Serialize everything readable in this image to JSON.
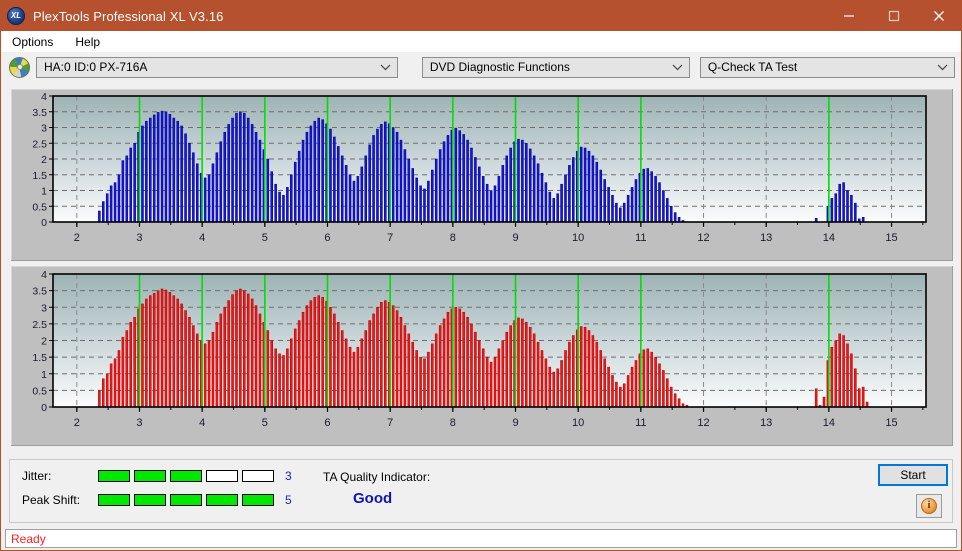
{
  "window": {
    "title": "PlexTools Professional XL V3.16",
    "app_icon": "xl-disc-icon",
    "icon_label": "XL",
    "accent_color": "#b5512e",
    "minimize_label": "Minimize",
    "maximize_label": "Maximize",
    "close_label": "Close"
  },
  "menubar": {
    "items": [
      {
        "label": "Options"
      },
      {
        "label": "Help"
      }
    ]
  },
  "toolbar": {
    "drive_icon": "disc-icon",
    "drive_select": {
      "value": "HA:0 ID:0  PX-716A",
      "options": [
        "HA:0 ID:0  PX-716A"
      ]
    },
    "function_select": {
      "value": "DVD Diagnostic Functions",
      "options": [
        "DVD Diagnostic Functions"
      ]
    },
    "test_select": {
      "value": "Q-Check TA Test",
      "options": [
        "Q-Check TA Test"
      ]
    }
  },
  "results": {
    "jitter": {
      "label": "Jitter:",
      "value": "3",
      "segments_total": 5,
      "segments_filled": 3
    },
    "peak_shift": {
      "label": "Peak Shift:",
      "value": "5",
      "segments_total": 5,
      "segments_filled": 5
    },
    "ta_quality": {
      "label": "TA Quality Indicator:",
      "value": "Good",
      "value_color": "#1414b4"
    },
    "start_button": "Start",
    "info_button": "info-icon",
    "info_glyph": "i"
  },
  "statusbar": {
    "text": "Ready",
    "color": "#ff2020"
  },
  "chart_data": [
    {
      "id": "top",
      "type": "bar",
      "title": "",
      "series_name": "Jitter",
      "color": "#1414e6",
      "bar_edge_color": "#000080",
      "xlabel": "",
      "ylabel": "",
      "xlim": [
        1.62,
        15.55
      ],
      "ylim": [
        0,
        4
      ],
      "yticks": [
        0,
        0.5,
        1,
        1.5,
        2,
        2.5,
        3,
        3.5,
        4
      ],
      "ytick_labels": [
        "0",
        "0.5",
        "1",
        "1.5",
        "2",
        "2.5",
        "3",
        "3.5",
        "4"
      ],
      "xticks": [
        2,
        3,
        4,
        5,
        6,
        7,
        8,
        9,
        10,
        11,
        12,
        13,
        14,
        15
      ],
      "xtick_labels": [
        "2",
        "3",
        "4",
        "5",
        "6",
        "7",
        "8",
        "9",
        "10",
        "11",
        "12",
        "13",
        "14",
        "15"
      ],
      "grid": true,
      "marker_lines": [
        3,
        4,
        5,
        6,
        7,
        8,
        9,
        10,
        11,
        14
      ],
      "marker_color": "#00e000",
      "bar_start_x": 2.36,
      "bar_step": 0.0625,
      "values": [
        0.35,
        0.65,
        0.9,
        1.15,
        1.25,
        1.5,
        1.95,
        2.1,
        2.35,
        2.5,
        2.85,
        3.05,
        3.2,
        3.3,
        3.4,
        3.48,
        3.52,
        3.5,
        3.42,
        3.3,
        3.2,
        3.05,
        2.8,
        2.5,
        2.2,
        1.85,
        1.55,
        1.4,
        1.5,
        1.85,
        2.2,
        2.55,
        2.85,
        3.1,
        3.3,
        3.45,
        3.5,
        3.45,
        3.3,
        3.1,
        2.85,
        2.6,
        2.3,
        2.0,
        1.6,
        1.2,
        0.95,
        0.85,
        1.1,
        1.5,
        1.9,
        2.25,
        2.6,
        2.85,
        3.05,
        3.2,
        3.3,
        3.25,
        3.12,
        2.95,
        2.7,
        2.4,
        2.1,
        1.8,
        1.5,
        1.3,
        1.45,
        1.75,
        2.1,
        2.45,
        2.75,
        2.95,
        3.1,
        3.18,
        3.12,
        3.0,
        2.85,
        2.6,
        2.3,
        2.0,
        1.7,
        1.4,
        1.15,
        1.05,
        1.3,
        1.65,
        2.0,
        2.3,
        2.55,
        2.75,
        2.92,
        2.98,
        2.9,
        2.78,
        2.6,
        2.35,
        2.05,
        1.75,
        1.45,
        1.2,
        1.0,
        1.15,
        1.45,
        1.8,
        2.1,
        2.35,
        2.55,
        2.63,
        2.6,
        2.5,
        2.32,
        2.1,
        1.85,
        1.55,
        1.25,
        0.95,
        0.75,
        0.9,
        1.2,
        1.5,
        1.8,
        2.05,
        2.25,
        2.38,
        2.35,
        2.25,
        2.1,
        1.9,
        1.65,
        1.35,
        1.1,
        0.85,
        0.6,
        0.45,
        0.6,
        0.85,
        1.1,
        1.35,
        1.55,
        1.68,
        1.7,
        1.6,
        1.45,
        1.25,
        1.0,
        0.75,
        0.5,
        0.3,
        0.15,
        0.05,
        0,
        0,
        0,
        0,
        0,
        0,
        0,
        0,
        0,
        0,
        0,
        0,
        0,
        0,
        0,
        0,
        0,
        0,
        0,
        0,
        0,
        0,
        0,
        0,
        0,
        0,
        0,
        0,
        0,
        0,
        0,
        0,
        0,
        0.12,
        0,
        0,
        0.5,
        0.75,
        0.9,
        1.2,
        1.25,
        1.0,
        0.85,
        0.6,
        0.1,
        0.15,
        0,
        0,
        0,
        0,
        0,
        0,
        0,
        0,
        0,
        0,
        0,
        0,
        0,
        0
      ]
    },
    {
      "id": "bottom",
      "type": "bar",
      "title": "",
      "series_name": "Peak Shift",
      "color": "#f51414",
      "bar_edge_color": "#b00000",
      "xlabel": "",
      "ylabel": "",
      "xlim": [
        1.62,
        15.55
      ],
      "ylim": [
        0,
        4
      ],
      "yticks": [
        0,
        0.5,
        1,
        1.5,
        2,
        2.5,
        3,
        3.5,
        4
      ],
      "ytick_labels": [
        "0",
        "0.5",
        "1",
        "1.5",
        "2",
        "2.5",
        "3",
        "3.5",
        "4"
      ],
      "xticks": [
        2,
        3,
        4,
        5,
        6,
        7,
        8,
        9,
        10,
        11,
        12,
        13,
        14,
        15
      ],
      "xtick_labels": [
        "2",
        "3",
        "4",
        "5",
        "6",
        "7",
        "8",
        "9",
        "10",
        "11",
        "12",
        "13",
        "14",
        "15"
      ],
      "grid": true,
      "marker_lines": [
        3,
        4,
        5,
        6,
        7,
        8,
        9,
        10,
        11,
        14
      ],
      "marker_color": "#00e000",
      "bar_start_x": 2.36,
      "bar_step": 0.0625,
      "values": [
        0.5,
        0.85,
        1.0,
        1.3,
        1.45,
        1.7,
        2.1,
        2.3,
        2.55,
        2.7,
        2.95,
        3.1,
        3.25,
        3.35,
        3.42,
        3.5,
        3.55,
        3.52,
        3.45,
        3.35,
        3.25,
        3.1,
        2.9,
        2.7,
        2.45,
        2.2,
        2.0,
        1.9,
        2.0,
        2.25,
        2.55,
        2.8,
        3.0,
        3.2,
        3.38,
        3.5,
        3.55,
        3.5,
        3.4,
        3.25,
        3.05,
        2.8,
        2.55,
        2.3,
        2.0,
        1.75,
        1.6,
        1.55,
        1.75,
        2.05,
        2.35,
        2.6,
        2.85,
        3.05,
        3.2,
        3.3,
        3.35,
        3.3,
        3.18,
        3.0,
        2.8,
        2.55,
        2.3,
        2.05,
        1.8,
        1.65,
        1.8,
        2.05,
        2.3,
        2.6,
        2.8,
        3.0,
        3.15,
        3.2,
        3.15,
        3.05,
        2.9,
        2.7,
        2.45,
        2.2,
        1.95,
        1.7,
        1.5,
        1.45,
        1.65,
        1.9,
        2.2,
        2.45,
        2.65,
        2.85,
        2.95,
        3.0,
        2.95,
        2.85,
        2.7,
        2.5,
        2.25,
        2.0,
        1.75,
        1.5,
        1.35,
        1.5,
        1.75,
        2.0,
        2.25,
        2.45,
        2.6,
        2.68,
        2.65,
        2.55,
        2.4,
        2.2,
        1.95,
        1.7,
        1.45,
        1.2,
        1.05,
        1.15,
        1.4,
        1.7,
        1.95,
        2.15,
        2.32,
        2.42,
        2.4,
        2.3,
        2.15,
        1.95,
        1.7,
        1.45,
        1.2,
        0.95,
        0.75,
        0.6,
        0.7,
        0.95,
        1.2,
        1.4,
        1.6,
        1.72,
        1.75,
        1.65,
        1.5,
        1.3,
        1.1,
        0.85,
        0.6,
        0.4,
        0.25,
        0.1,
        0.05,
        0,
        0,
        0,
        0,
        0,
        0,
        0,
        0,
        0,
        0,
        0,
        0,
        0,
        0,
        0,
        0,
        0,
        0,
        0,
        0,
        0,
        0,
        0,
        0,
        0,
        0,
        0,
        0,
        0,
        0,
        0,
        0,
        0.55,
        0.05,
        0.3,
        1.4,
        1.8,
        2.0,
        2.2,
        2.15,
        1.9,
        1.6,
        1.15,
        0.55,
        0.6,
        0.15,
        0,
        0,
        0,
        0,
        0,
        0,
        0,
        0,
        0,
        0,
        0,
        0,
        0
      ]
    }
  ]
}
